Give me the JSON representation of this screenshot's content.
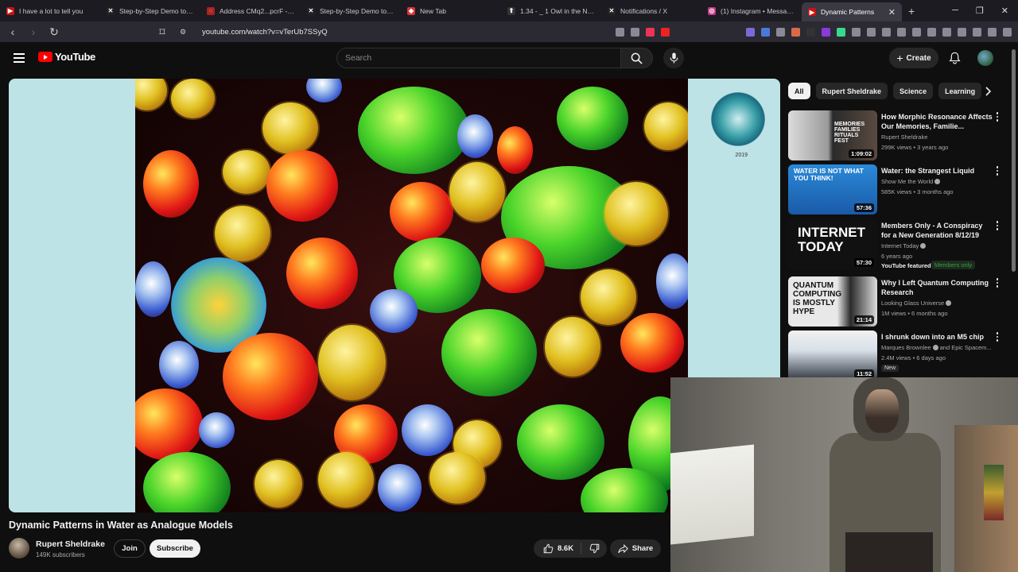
{
  "browser": {
    "tabs": [
      {
        "label": "I have a lot to tell you",
        "fav_color": "#c11",
        "fav_glyph": "▶"
      },
      {
        "label": "Step-by-Step Demo to Int",
        "fav_color": "#222",
        "fav_glyph": "✕"
      },
      {
        "label": "Address CMq2...pcrF - Ma",
        "fav_color": "#a22",
        "fav_glyph": "◌"
      },
      {
        "label": "Step-by-Step Demo to Int",
        "fav_color": "#222",
        "fav_glyph": "✕"
      },
      {
        "label": "New Tab",
        "fav_color": "#d33",
        "fav_glyph": "◆"
      },
      {
        "label": "1.34 - _ 1 Owl in the Night",
        "fav_color": "#333",
        "fav_glyph": "⬆"
      },
      {
        "label": "Notifications / X",
        "fav_color": "#222",
        "fav_glyph": "✕"
      },
      {
        "label": "(1) Instagram • Messages",
        "fav_color": "#c13584",
        "fav_glyph": "◎"
      },
      {
        "label": "Dynamic Patterns",
        "fav_color": "#c11",
        "fav_glyph": "▶",
        "active": true
      }
    ],
    "url": "youtube.com/watch?v=vTerUb7SSyQ"
  },
  "header": {
    "logo_text": "YouTube",
    "search_placeholder": "Search",
    "create_label": "Create"
  },
  "video": {
    "title": "Dynamic Patterns in Water as Analogue Models",
    "seal_year": "2019",
    "channel_name": "Rupert Sheldrake",
    "subscribers": "149K subscribers",
    "join_label": "Join",
    "subscribe_label": "Subscribe",
    "likes": "8.6K",
    "share_label": "Share"
  },
  "chips": [
    "All",
    "Rupert Sheldrake",
    "Science",
    "Learning"
  ],
  "recommendations": [
    {
      "title": "How Morphic Resonance Affects Our Memories, Familie...",
      "channel": "Rupert Sheldrake",
      "verified": false,
      "meta": "299K views • 3 years ago",
      "duration": "1:09:02",
      "thumb_text": "MEMORIES FAMILIES RITUALS FEST"
    },
    {
      "title": "Water: the Strangest Liquid",
      "channel": "Show Me the World",
      "verified": true,
      "meta": "585K views • 3 months ago",
      "duration": "57:36",
      "thumb_text": "WATER IS NOT WHAT YOU THINK!"
    },
    {
      "title": "Members Only - A Conspiracy for a New Generation 8/12/19",
      "channel": "Internet Today",
      "verified": true,
      "meta": "6 years ago",
      "duration": "57:30",
      "thumb_text": "INTERNET TODAY",
      "badge": "YouTube featured",
      "badge2": "Members only"
    },
    {
      "title": "Why I Left Quantum Computing Research",
      "channel": "Looking Glass Universe",
      "verified": true,
      "meta": "1M views • 6 months ago",
      "duration": "21:14",
      "thumb_text": "QUANTUM COMPUTING IS MOSTLY HYPE"
    },
    {
      "title": "I shrunk down into an M5 chip",
      "channel": "Marques Brownlee",
      "channel_extra": "and Epic Spacem...",
      "verified": true,
      "meta": "2.4M views • 6 days ago",
      "duration": "11:52",
      "badge_new": "New"
    }
  ],
  "colors": {
    "background": "#0f0f0f",
    "youtube_red": "#ff0000",
    "player_bg": "#bde3e6",
    "members_green": "#2ba640"
  }
}
